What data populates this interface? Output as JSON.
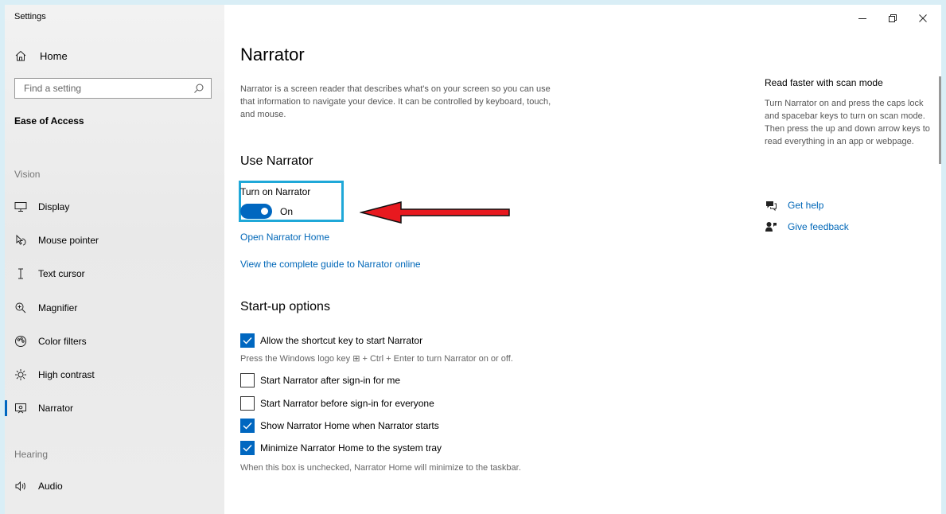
{
  "window": {
    "title": "Settings"
  },
  "sidebar": {
    "home_label": "Home",
    "search_placeholder": "Find a setting",
    "section_title": "Ease of Access",
    "groups": {
      "vision": "Vision",
      "hearing": "Hearing"
    },
    "items": [
      {
        "label": "Display",
        "icon": "monitor-icon"
      },
      {
        "label": "Mouse pointer",
        "icon": "mouse-pointer-icon"
      },
      {
        "label": "Text cursor",
        "icon": "text-cursor-icon"
      },
      {
        "label": "Magnifier",
        "icon": "magnifier-icon"
      },
      {
        "label": "Color filters",
        "icon": "color-filters-icon"
      },
      {
        "label": "High contrast",
        "icon": "high-contrast-icon"
      },
      {
        "label": "Narrator",
        "icon": "narrator-icon",
        "selected": true
      },
      {
        "label": "Audio",
        "icon": "audio-icon"
      }
    ]
  },
  "main": {
    "title": "Narrator",
    "description": "Narrator is a screen reader that describes what's on your screen so you can use that information to navigate your device. It can be controlled by keyboard, touch, and mouse.",
    "use_narrator": {
      "heading": "Use Narrator",
      "toggle_label": "Turn on Narrator",
      "toggle_state": "On",
      "toggle_on": true,
      "link_home": "Open Narrator Home",
      "link_guide": "View the complete guide to Narrator online"
    },
    "startup": {
      "heading": "Start-up options",
      "options": [
        {
          "label": "Allow the shortcut key to start Narrator",
          "checked": true
        },
        {
          "label": "Start Narrator after sign-in for me",
          "checked": false
        },
        {
          "label": "Start Narrator before sign-in for everyone",
          "checked": false
        },
        {
          "label": "Show Narrator Home when Narrator starts",
          "checked": true
        },
        {
          "label": "Minimize Narrator Home to the system tray",
          "checked": true
        }
      ],
      "shortcut_hint": "Press the Windows logo key ⊞ + Ctrl + Enter to turn Narrator on or off.",
      "tray_hint": "When this box is unchecked, Narrator Home will minimize to the taskbar."
    }
  },
  "rail": {
    "title": "Read faster with scan mode",
    "text": "Turn Narrator on and press the caps lock and spacebar keys to turn on scan mode. Then press the up and down arrow keys to read everything in an app or webpage.",
    "links": {
      "help": "Get help",
      "feedback": "Give feedback"
    }
  },
  "colors": {
    "accent": "#0067c0",
    "link": "#0067b8",
    "highlight_box": "#1fa8d8",
    "annotation_arrow": "#e8191f"
  }
}
